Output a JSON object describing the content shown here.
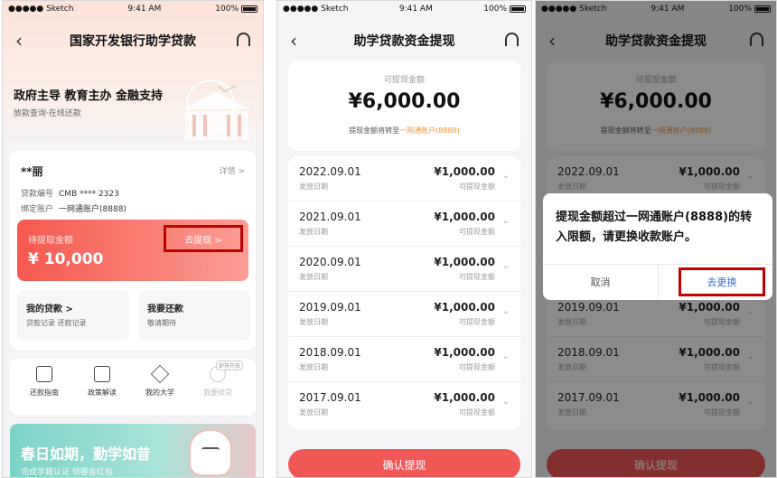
{
  "status": {
    "carrier": "●●●●● Sketch",
    "time": "9:41 AM",
    "battery": "100%"
  },
  "home": {
    "title": "国家开发银行助学贷款",
    "slogan": "政府主导 教育主办 金融支持",
    "sub": "放款查询·在线还款",
    "name": "**丽",
    "detail": "详情 >",
    "loan_no_label": "贷款编号",
    "loan_no": "CMB **** 2323",
    "account_label": "绑定账户",
    "account": "一网通账户(8888)",
    "pending_label": "待提取金额",
    "pending_amount": "¥ 10,000",
    "withdraw_btn": "去提现 >",
    "my_loans": "我的贷款 >",
    "my_loans_sub": "贷款记录 还款记录",
    "repay": "我要还款",
    "repay_sub": "敬请期待",
    "icons": [
      {
        "label": "还款指南",
        "icon": "guide-icon"
      },
      {
        "label": "政策解读",
        "icon": "policy-icon"
      },
      {
        "label": "我的大学",
        "icon": "graduation-cap-icon"
      },
      {
        "label": "我要续贷",
        "icon": "renew-icon",
        "badge": "即将开放"
      }
    ],
    "banner_title": "春日如期，勤学如昔",
    "banner_sub": "完成学籍认证 领要金红包"
  },
  "withdraw": {
    "title": "助学贷款资金提现",
    "balance_label": "可提现金额",
    "balance": "¥6,000.00",
    "note_prefix": "提现金额将转至",
    "note_account": "一网通账户(8888)",
    "date_label": "发放日期",
    "amount_label": "可提现金额",
    "records": [
      {
        "date": "2022.09.01",
        "amount": "¥1,000.00"
      },
      {
        "date": "2021.09.01",
        "amount": "¥1,000.00"
      },
      {
        "date": "2020.09.01",
        "amount": "¥1,000.00"
      },
      {
        "date": "2019.09.01",
        "amount": "¥1,000.00"
      },
      {
        "date": "2018.09.01",
        "amount": "¥1,000.00"
      },
      {
        "date": "2017.09.01",
        "amount": "¥1,000.00"
      }
    ],
    "confirm": "确认提现"
  },
  "dialog": {
    "message": "提现金额超过一网通账户(8888)的转入限额，请更换收款账户。",
    "cancel": "取消",
    "change": "去更换"
  }
}
